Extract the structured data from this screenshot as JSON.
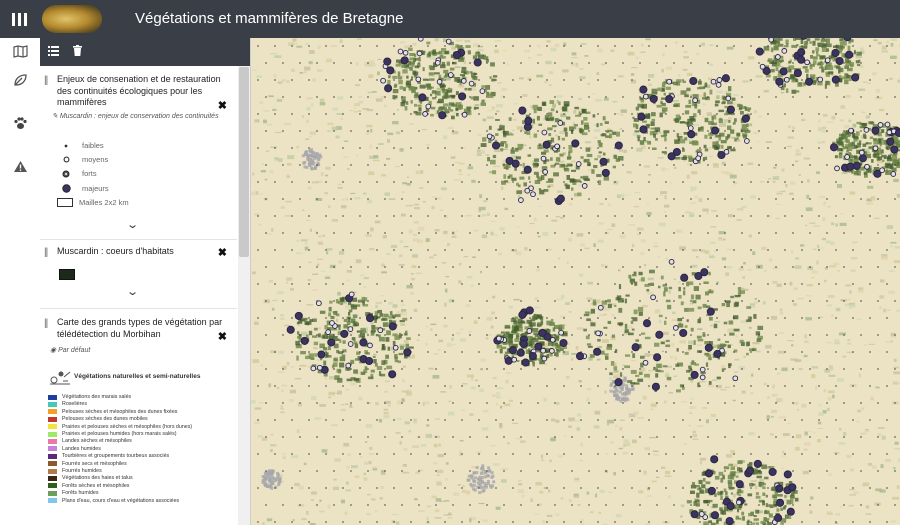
{
  "header": {
    "title": "Végétations et mammifères de Bretagne"
  },
  "colors": {
    "topbar": "#3a3f47",
    "map_base": "#ebe3c4",
    "forest": "#5f7a3e",
    "marker": "#3b3360"
  },
  "left_toolbar": {
    "icons": [
      "map-icon",
      "leaf-icon",
      "paw-icon",
      "warning-icon"
    ]
  },
  "panel": {
    "toolbar_icons": [
      "list-icon",
      "trash-icon"
    ],
    "layers": [
      {
        "title": "Enjeux de consenation et de restauration des continuités écologiques pour les mammifères",
        "subtitle": "Muscardin : enjeux de conservation des continuités",
        "legend": [
          "faibles",
          "moyens",
          "forts",
          "majeurs",
          "Mailles 2x2 km"
        ]
      },
      {
        "title": "Muscardin : coeurs d'habitats",
        "swatch_color": "#1c2a1c"
      },
      {
        "title": "Carte des grands types de végétation par télédétection du Morbihan",
        "subtitle": "Par défaut",
        "group_title": "Végétations naturelles et semi-naturelles",
        "classes": [
          {
            "label": "Végétations des marais salés",
            "color": "#1f3f9e"
          },
          {
            "label": "Roselières",
            "color": "#43c9b8"
          },
          {
            "label": "Pelouses sèches et mésophiles des dunes fixées",
            "color": "#f2a126"
          },
          {
            "label": "Pelouses sèches des dunes mobiles",
            "color": "#c0392b"
          },
          {
            "label": "Prairies et pelouses sèches et mésophiles (hors dunes)",
            "color": "#f1e43c"
          },
          {
            "label": "Prairies et pelouses humides (hors marais salés)",
            "color": "#9ee86a"
          },
          {
            "label": "Landes sèches et mésophiles",
            "color": "#e87aa6"
          },
          {
            "label": "Landes humides",
            "color": "#c681d8"
          },
          {
            "label": "Tourbières et groupements tourbeux associés",
            "color": "#5a2a7a"
          },
          {
            "label": "Fourrés secs et mésophiles",
            "color": "#8a5a2b"
          },
          {
            "label": "Fourrés humides",
            "color": "#b07a4a"
          },
          {
            "label": "Végétations des haies et talus",
            "color": "#3d2416"
          },
          {
            "label": "Forêts sèches et mésophiles",
            "color": "#2f5e1f"
          },
          {
            "label": "Forêts humides",
            "color": "#6aa05a"
          },
          {
            "label": "Plans d'eau, cours d'eau et végétations associées",
            "color": "#7fc7e8"
          }
        ]
      }
    ]
  }
}
